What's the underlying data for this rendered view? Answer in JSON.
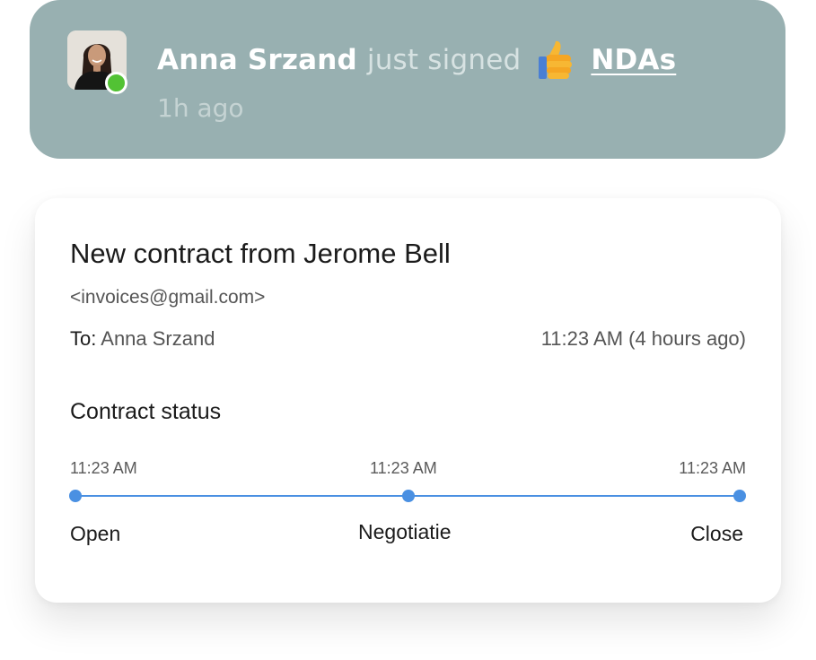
{
  "notification": {
    "user_name": "Anna Srzand",
    "action_text": "just signed",
    "emoji_icon": "thumbs-up-icon",
    "link_text": "NDAs",
    "time_ago": "1h ago",
    "status_color": "#52c234",
    "background_color": "#98b0b1"
  },
  "contract": {
    "title": "New contract from Jerome Bell",
    "sender_email": "<invoices@gmail.com>",
    "to_label": "To:",
    "recipient": "Anna Srzand",
    "sent_time": "11:23 AM (4 hours ago)",
    "status_heading": "Contract status",
    "accent_color": "#4a90e2",
    "stages": [
      {
        "time": "11:23 AM",
        "label": "Open"
      },
      {
        "time": "11:23 AM",
        "label": "Negotiatie"
      },
      {
        "time": "11:23 AM",
        "label": "Close"
      }
    ]
  }
}
